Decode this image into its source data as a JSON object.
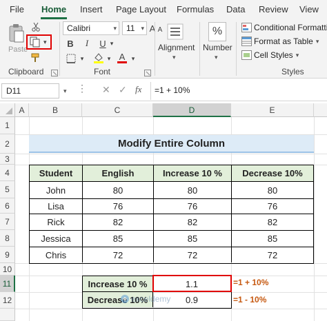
{
  "tabs": [
    "File",
    "Home",
    "Insert",
    "Page Layout",
    "Formulas",
    "Data",
    "Review",
    "View"
  ],
  "ribbon": {
    "paste_label": "Paste",
    "clipboard_label": "Clipboard",
    "font_name": "Calibri",
    "font_size": "11",
    "font_label": "Font",
    "alignment_label": "Alignment",
    "number_label": "Number",
    "conditional_formatting": "Conditional Formatting",
    "format_as_table": "Format as Table",
    "cell_styles": "Cell Styles",
    "styles_label": "Styles",
    "bold": "B",
    "italic": "I",
    "underline": "U",
    "percent_symbol": "%",
    "font_color_letter": "A",
    "grow_font": "A",
    "shrink_font": "A"
  },
  "formula_bar": {
    "name_box": "D11",
    "fx": "fx",
    "formula": "=1 + 10%"
  },
  "grid": {
    "columns": [
      "A",
      "B",
      "C",
      "D",
      "E"
    ],
    "rows": [
      "1",
      "2",
      "3",
      "4",
      "5",
      "6",
      "7",
      "8",
      "9",
      "10",
      "11",
      "12"
    ],
    "title": "Modify Entire Column",
    "table_headers": [
      "Student",
      "English",
      "Increase 10 %",
      "Decrease 10%"
    ],
    "table_rows": [
      [
        "John",
        "80",
        "80",
        "80"
      ],
      [
        "Lisa",
        "76",
        "76",
        "76"
      ],
      [
        "Rick",
        "82",
        "82",
        "82"
      ],
      [
        "Jessica",
        "85",
        "85",
        "85"
      ],
      [
        "Chris",
        "72",
        "72",
        "72"
      ]
    ],
    "calc": [
      {
        "label": "Increase 10 %",
        "value": "1.1",
        "note": "=1 + 10%"
      },
      {
        "label": "Decrease 10%",
        "value": "0.9",
        "note": "=1 - 10%"
      }
    ],
    "watermark": "exceldemy"
  },
  "colors": {
    "accent": "#1e7145",
    "title_fill": "#ddebf7",
    "table_header_fill": "#e2efda",
    "note_color": "#c65911",
    "highlight_border": "#e00000"
  }
}
